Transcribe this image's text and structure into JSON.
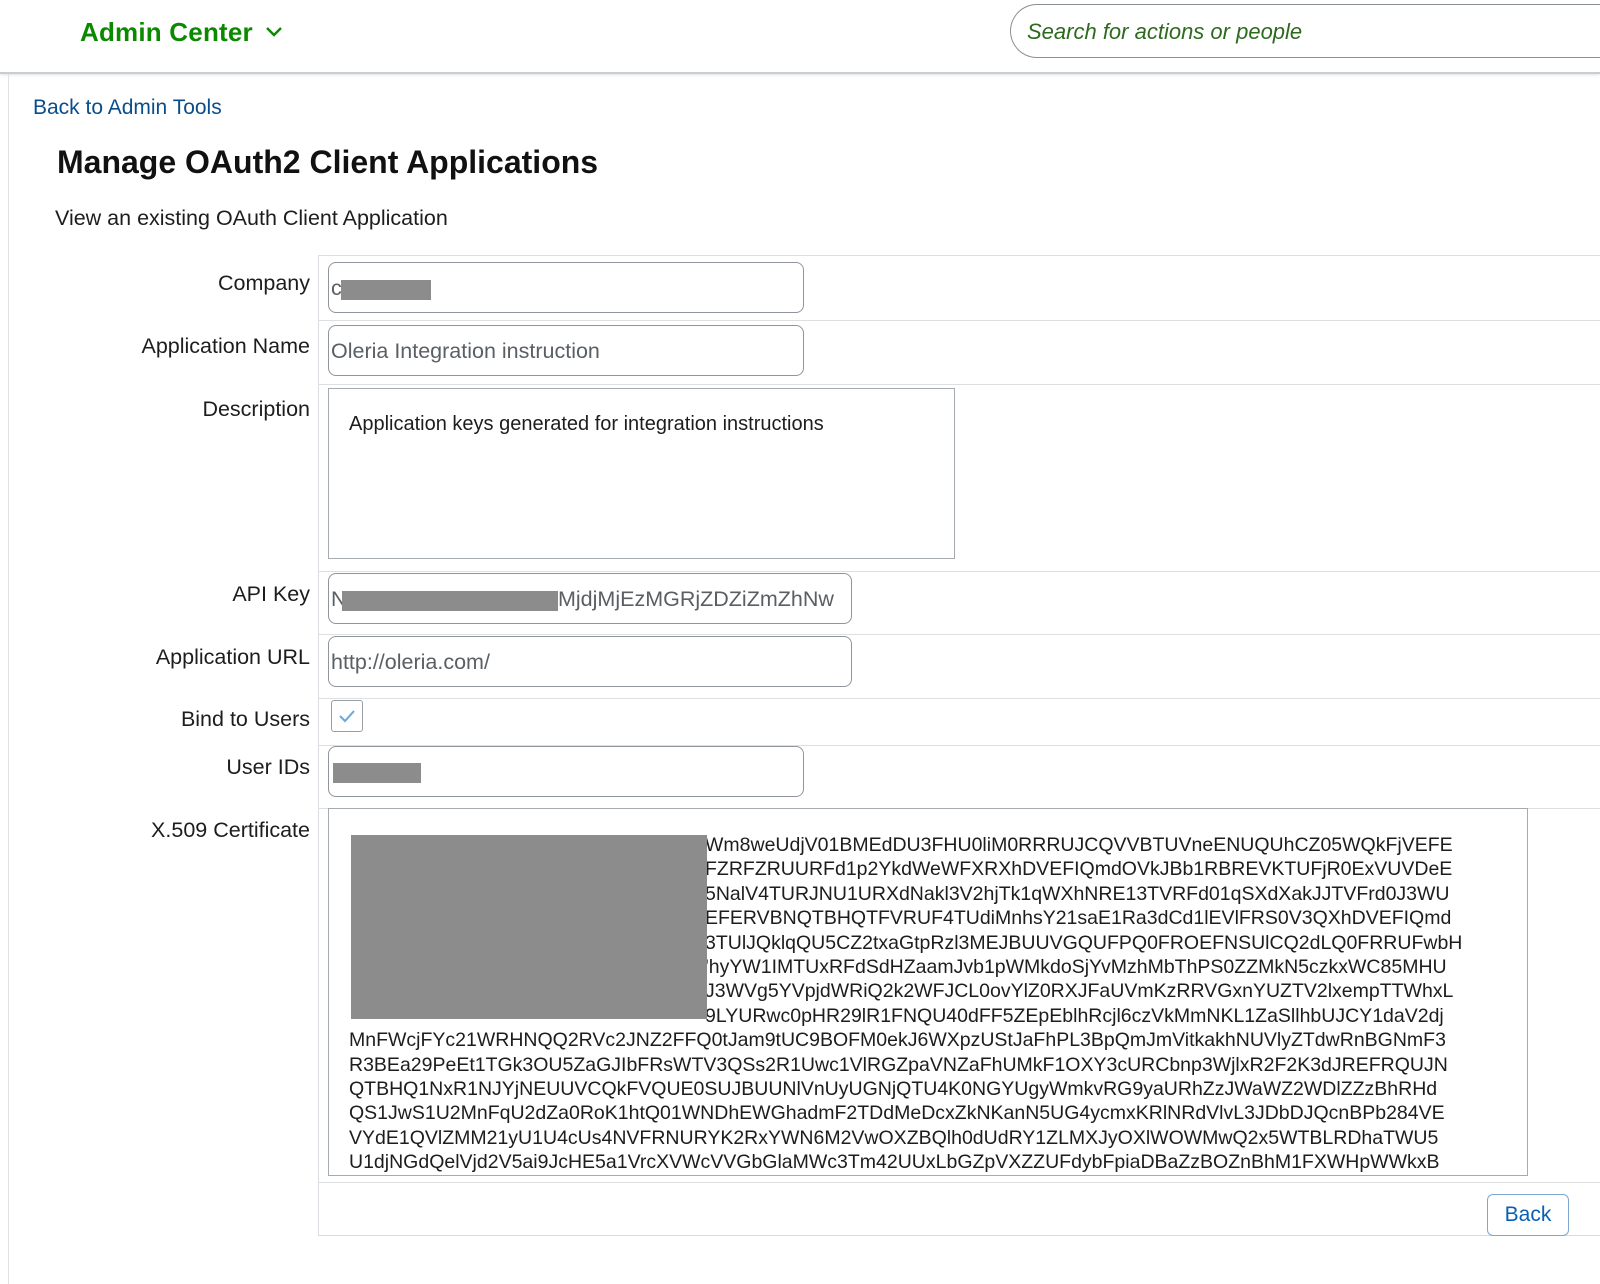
{
  "header": {
    "app_title": "Admin Center",
    "search_placeholder": "Search for actions or people"
  },
  "nav": {
    "back_link": "Back to Admin Tools"
  },
  "page": {
    "title": "Manage OAuth2 Client Applications",
    "subtitle": "View an existing OAuth Client Application"
  },
  "form": {
    "company": {
      "label": "Company",
      "value_visible": "c"
    },
    "application_name": {
      "label": "Application Name",
      "value": "Oleria Integration instruction"
    },
    "description": {
      "label": "Description",
      "value": "Application keys generated for integration instructions"
    },
    "api_key": {
      "label": "API Key",
      "value_prefix": "N",
      "value_suffix": "MjdjMjEzMGRjZDZiZmZhNw"
    },
    "application_url": {
      "label": "Application URL",
      "value": "http://oleria.com/"
    },
    "bind_to_users": {
      "label": "Bind to Users",
      "checked": true
    },
    "user_ids": {
      "label": "User IDs"
    },
    "certificate": {
      "label": "X.509 Certificate",
      "lines": [
        "Wm8weUdjV01BMEdDU3FHU0liM0RRRUJCQVVBTUVneENUQUhCZ05WQkFjVEFE",
        "FZRFZRUURFd1p2YkdWeWFXRXhDVEFIQmdOVkJBb1RBREVKTUFjR0ExVUVDeE",
        "5NalV4TURJNU1URXdNakl3V2hjTk1qWXhNRE13TVRFd01qSXdXakJJTVFrd0J3WU",
        "EFERVBNQTBHQTFVRUF4TUdiMnhsY21saE1Ra3dCd1lEVlFRS0V3QXhDVEFIQmd",
        "3TUlJQklqQU5CZ2txaGtpRzl3MEJBUUVGQUFPQ0FROEFNSUlCQ2dLQ0FRRUFwbH",
        "'hyYW1IMTUxRFdSdHZaamJvb1pWMkdoSjYvMzhMbThPS0ZZMkN5czkxWC85MHU",
        "J3WVg5YVpjdWRiQ2k2WFJCL0ovYlZ0RXJFaUVmKzRRVGxnYUZTV2lxempTTWhxL",
        "9LYURwc0pHR29lR1FNQU40dFF5ZEpEblhRcjl6czVkMmNKL1ZaSllhbUJCY1daV2dj",
        "MnFWcjFYc21WRHNQQ2RVc2JNZ2FFQ0tJam9tUC9BOFM0ekJ6WXpzUStJaFhPL3BpQmJmVitkakhNUVlyZTdwRnBGNmF3",
        "R3BEa29PeEt1TGk3OU5ZaGJIbFRsWTV3QSs2R1Uwc1VlRGZpaVNZaFhUMkF1OXY3cURCbnp3WjlxR2F2K3dJREFRQUJN",
        "QTBHQ1NxR1NJYjNEUUVCQkFVQUE0SUJBUUNlVnUyUGNjQTU4K0NGYUgyWmkvRG9yaURhZzJWaWZ2WDlZZzBhRHd",
        "QS1JwS1U2MnFqU2dZa0RoK1htQ01WNDhEWGhadmF2TDdMeDcxZkNKanN5UG4ycmxKRlNRdVlvL3JDbDJQcnBPb284VE",
        "VYdE1QVlZMM21yU1U4cUs4NVFRNURYK2RxYWN6M2VwOXZBQlh0dUdRY1ZLMXJyOXlWOWMwQ2x5WTBLRDhaTWU5",
        "U1djNGdQelVjd2V5ai9JcHE5a1VrcXVWcVVGbGlaMWc3Tm42UUxLbGZpVXZZUFdybFpiaDBaZzBOZnBhM1FXWHpWWkxB"
      ]
    }
  },
  "buttons": {
    "back": "Back"
  },
  "colors": {
    "brand_green": "#0b8a00",
    "link_blue": "#0a4d8c",
    "redaction_gray": "#8c8c8c"
  }
}
